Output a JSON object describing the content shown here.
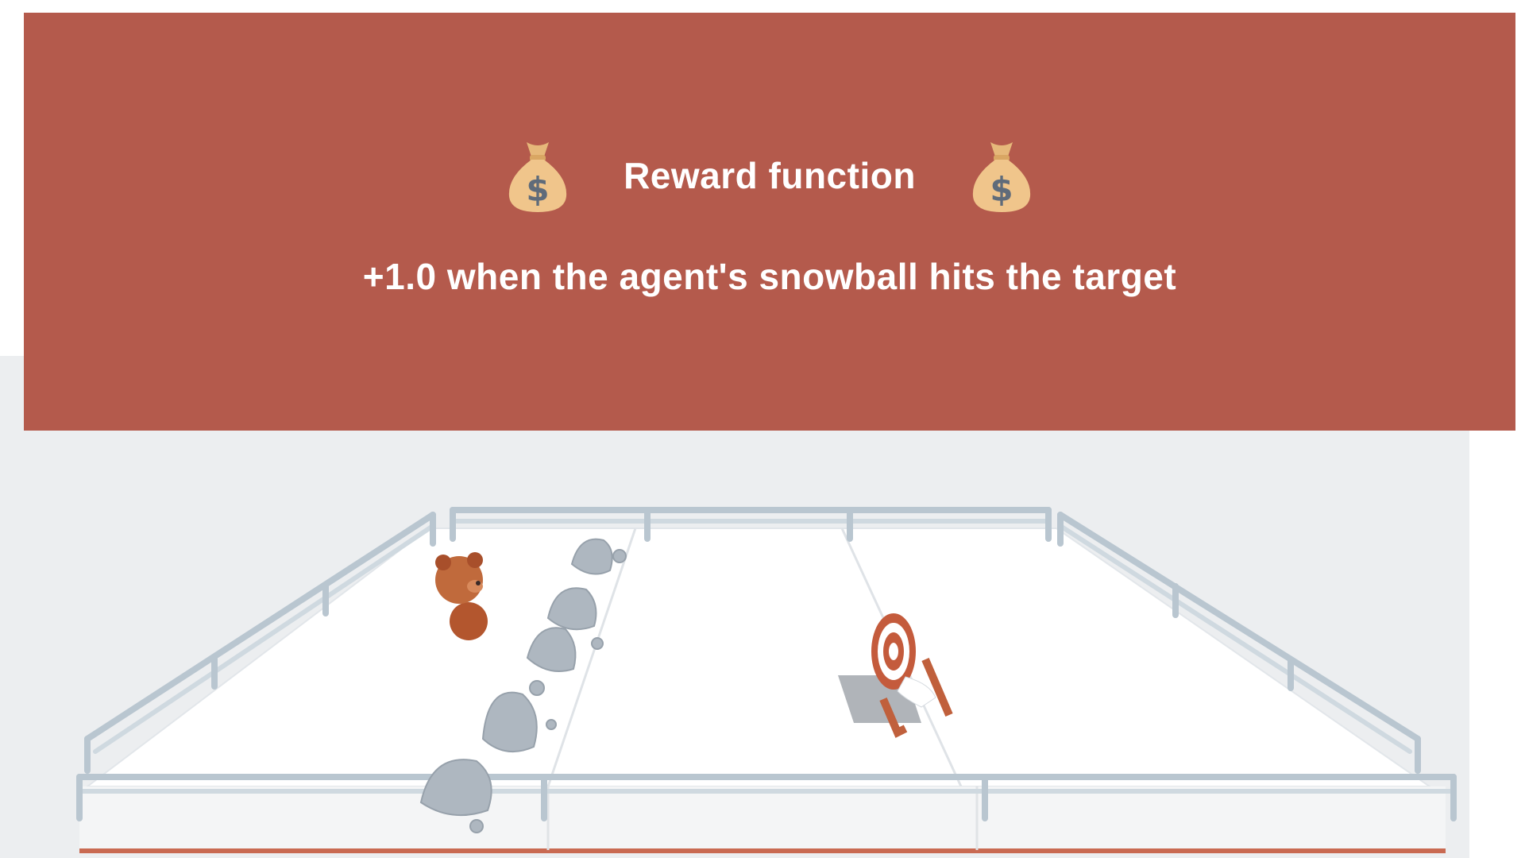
{
  "banner": {
    "title": "Reward function",
    "subtitle": "+1.0 when the agent's snowball hits the target",
    "icons": [
      "money-bag-icon",
      "money-bag-icon"
    ],
    "background_color": "#b45a4c",
    "text_color": "#ffffff"
  },
  "scene": {
    "agent": "bear-agent",
    "target": "archery-target",
    "obstacles": "rocks",
    "arena": "snow-field-with-railing",
    "background_color": "#eceef0"
  }
}
